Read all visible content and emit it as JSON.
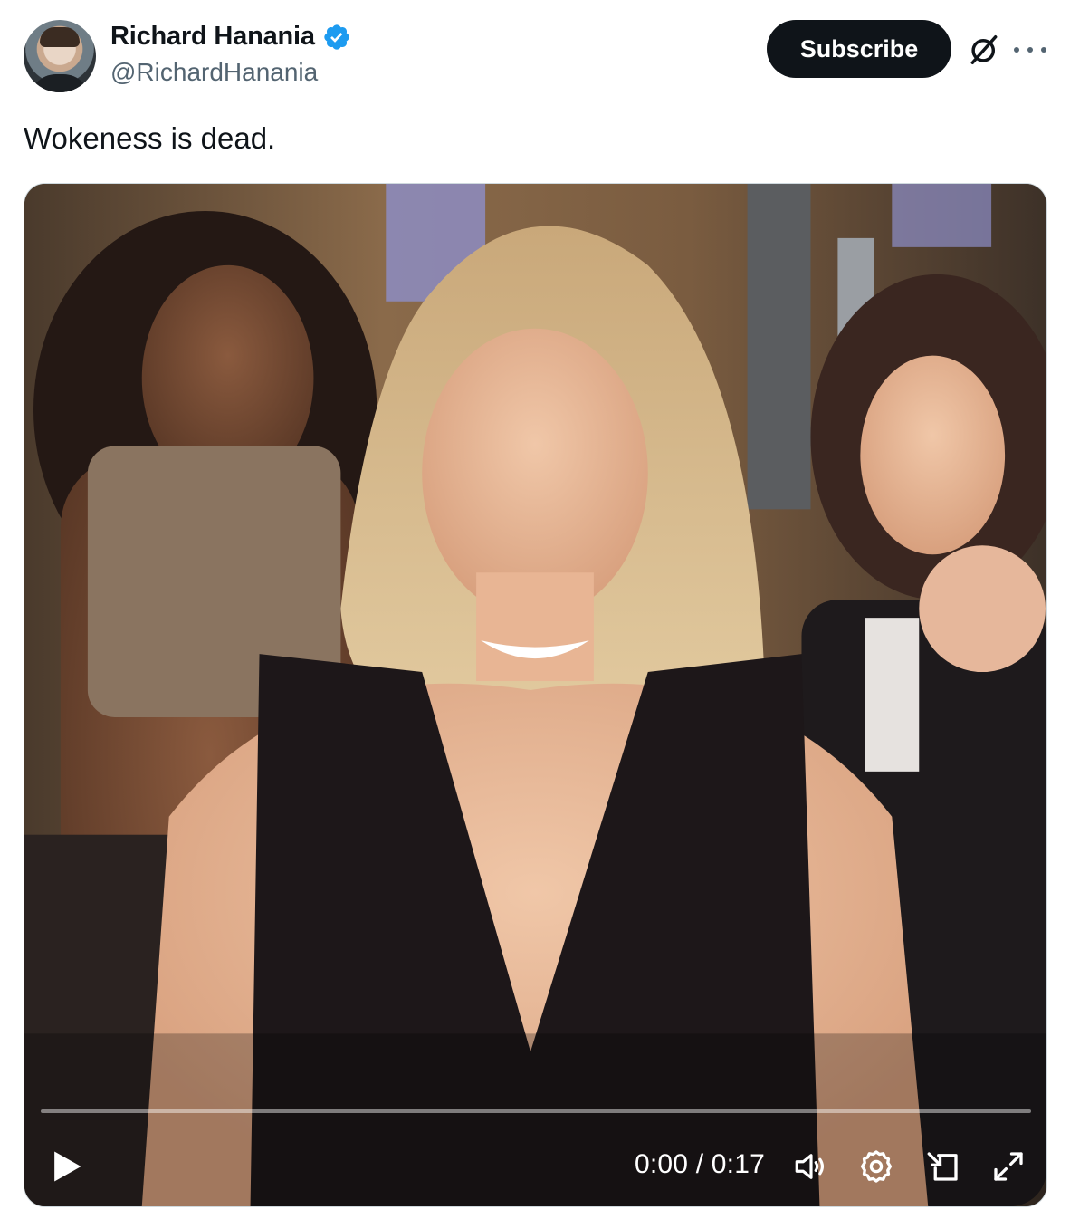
{
  "author": {
    "display_name": "Richard Hanania",
    "handle": "@RichardHanania"
  },
  "header": {
    "subscribe_label": "Subscribe"
  },
  "tweet": {
    "text": "Wokeness is dead."
  },
  "video": {
    "time_display": "0:00 / 0:17",
    "progress_fraction": 0.0
  },
  "icons": {
    "verified": "verified-badge-icon",
    "grok": "grok-icon",
    "more": "more-icon",
    "play": "play-icon",
    "volume": "volume-icon",
    "settings": "gear-icon",
    "pip": "picture-in-picture-icon",
    "fullscreen": "fullscreen-icon"
  },
  "colors": {
    "verified_blue": "#1d9bf0",
    "subscribe_bg": "#0f1419",
    "handle_gray": "#536471"
  }
}
